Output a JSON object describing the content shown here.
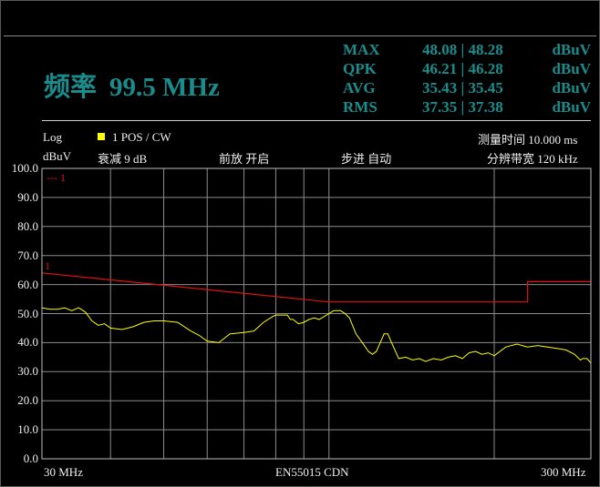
{
  "display": {
    "frequency_label": "频率",
    "frequency_value": "99.5 MHz"
  },
  "measurements": [
    {
      "name": "MAX",
      "value": "48.08 | 48.28",
      "unit": "dBuV"
    },
    {
      "name": "QPK",
      "value": "46.21 | 46.28",
      "unit": "dBuV"
    },
    {
      "name": "AVG",
      "value": "35.43 | 35.45",
      "unit": "dBuV"
    },
    {
      "name": "RMS",
      "value": "37.35 | 37.38",
      "unit": "dBuV"
    }
  ],
  "info_bar": {
    "scale": "Log",
    "unit": "dBuV",
    "trace_label": "1 POS / CW",
    "attenuation": "衰减  9 dB",
    "preamp": "前放  开启",
    "step": "步进  自动",
    "measure_time": "测量时间  10.000 ms",
    "rbw": "分辨带宽  120 kHz"
  },
  "colors": {
    "accent": "#1b8c8c",
    "trace": "#ffff00",
    "limit": "#e01010",
    "grid": "#8c8c8c"
  },
  "chart_data": {
    "type": "line",
    "x_scale": "log",
    "xlim": [
      30,
      300
    ],
    "ylim": [
      0,
      100
    ],
    "xlabel_left": "30 MHz",
    "xlabel_center": "EN55015 CDN",
    "xlabel_right": "300 MHz",
    "y_ticks": [
      "0.0",
      "10.0",
      "20.0",
      "30.0",
      "40.0",
      "50.0",
      "60.0",
      "70.0",
      "80.0",
      "90.0",
      "100.0"
    ],
    "limit_line": {
      "marker_label": "1",
      "legend_label": "--- 1",
      "x": [
        30,
        100,
        100,
        230,
        230,
        300
      ],
      "y": [
        64,
        54,
        54,
        54,
        61,
        61
      ]
    },
    "series": [
      {
        "x": [
          30,
          31,
          32,
          33,
          34,
          35,
          36,
          37,
          38,
          39,
          40,
          42,
          44,
          46,
          48,
          50,
          53,
          56,
          58,
          60,
          63,
          66,
          70,
          73,
          76,
          79,
          80,
          82,
          84,
          85,
          86,
          88,
          90,
          92,
          94,
          96,
          98,
          100,
          102,
          103,
          105,
          107,
          109,
          112,
          116,
          118,
          120,
          122,
          124,
          126,
          128,
          130,
          134,
          138,
          142,
          146,
          150,
          155,
          160,
          165,
          170,
          175,
          180,
          185,
          190,
          195,
          200,
          210,
          220,
          230,
          240,
          250,
          260,
          270,
          280,
          287,
          290,
          295,
          300
        ],
        "y": [
          52,
          51.5,
          51.5,
          52,
          51,
          52,
          50.5,
          47.5,
          46,
          46.5,
          45,
          44.5,
          45.5,
          47,
          47.5,
          47.5,
          47,
          44,
          42.5,
          40.5,
          40,
          43,
          43.5,
          44,
          47,
          49,
          49.5,
          49.5,
          49.5,
          48,
          48,
          46.5,
          47,
          48,
          48.5,
          48,
          49,
          50,
          51,
          51,
          51,
          50,
          48.5,
          43,
          39,
          37,
          36,
          37,
          40,
          43,
          43,
          40,
          34.5,
          35,
          34,
          34.5,
          33.5,
          34.5,
          34,
          35,
          35.5,
          34.5,
          36.5,
          37,
          36,
          36.5,
          35.5,
          38.5,
          39.5,
          38.5,
          39,
          38.5,
          38,
          37.5,
          36,
          34,
          34.5,
          34.5,
          33
        ]
      }
    ]
  }
}
